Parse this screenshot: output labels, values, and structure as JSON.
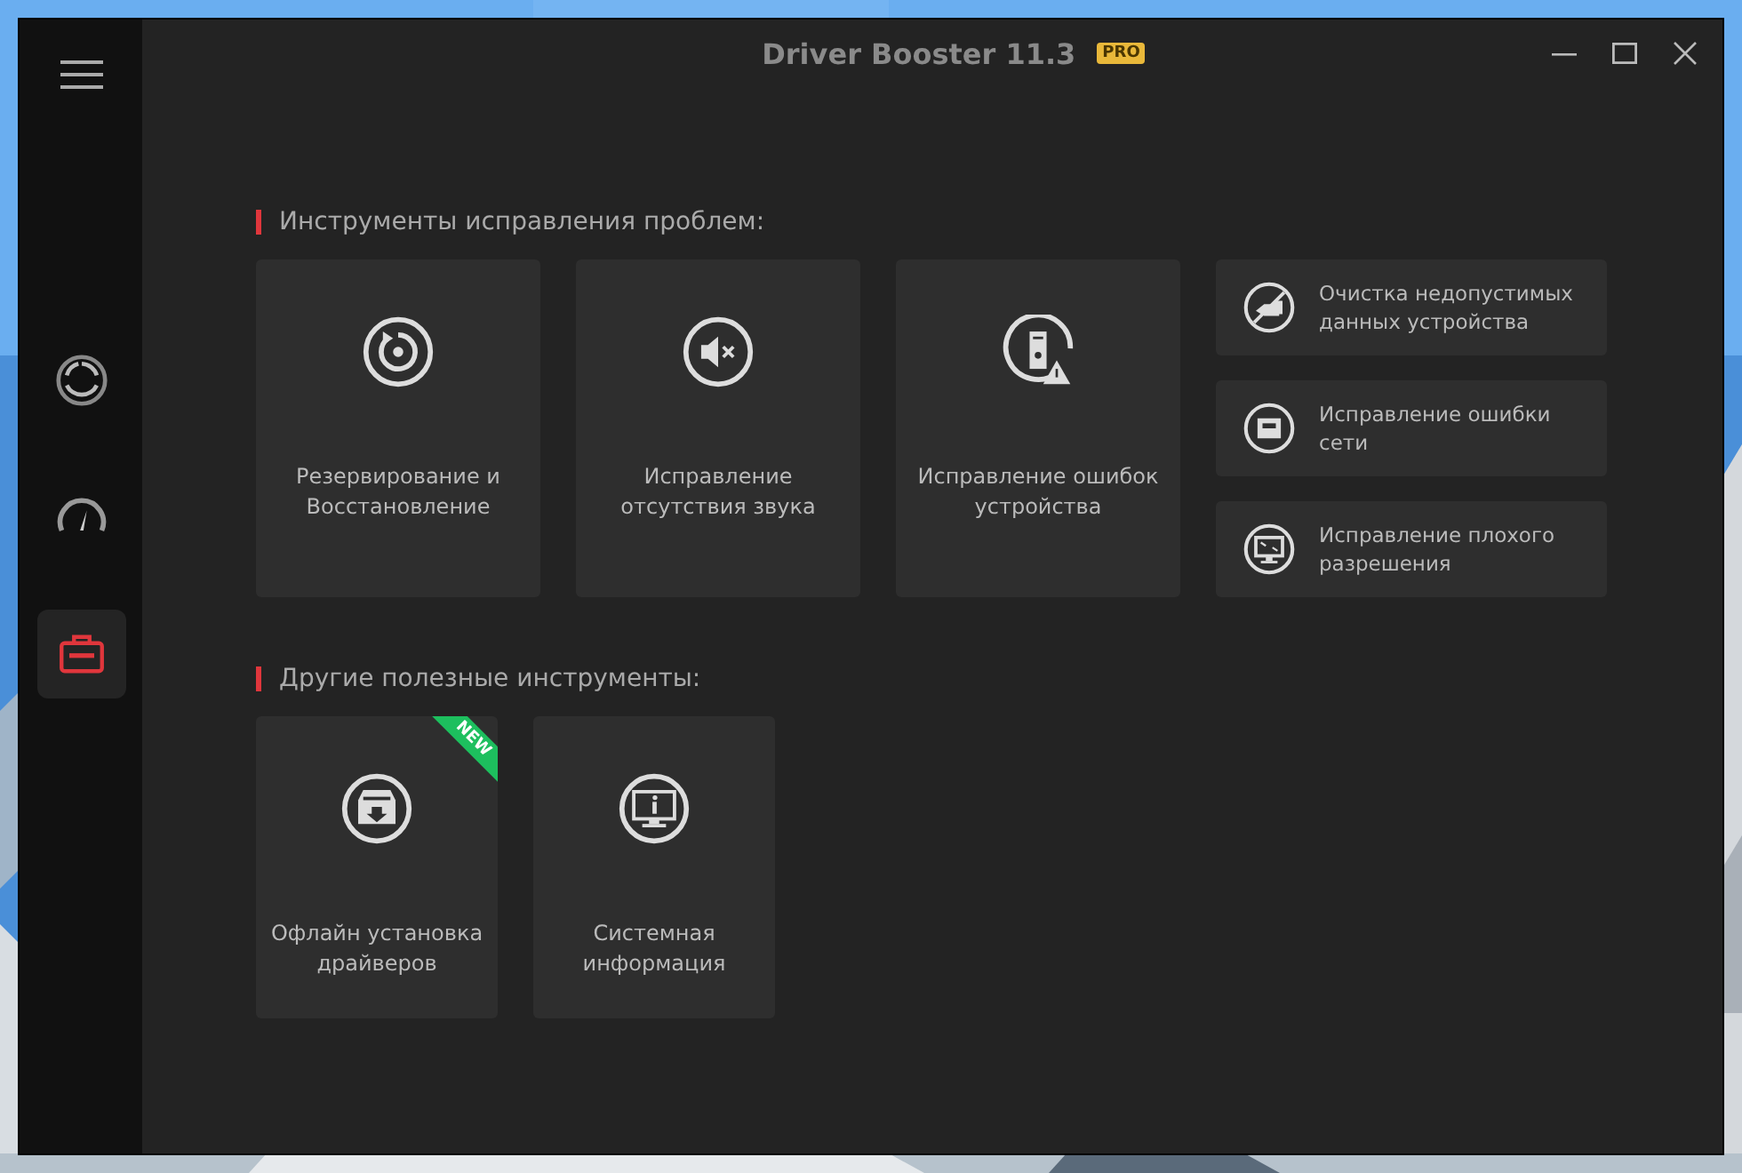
{
  "window": {
    "title": "Driver Booster 11.3",
    "badge": "PRO"
  },
  "sidebar": {
    "items": [
      {
        "kind": "scan",
        "selected": false
      },
      {
        "kind": "boost",
        "selected": false
      },
      {
        "kind": "toolbox",
        "selected": true
      }
    ]
  },
  "sections": [
    {
      "heading": "Инструменты исправления проблем:",
      "tools": [
        {
          "kind": "large",
          "label": "Резервирование и Восстановление"
        },
        {
          "kind": "large",
          "label": "Исправление отсутствия звука"
        },
        {
          "kind": "large",
          "label": "Исправление ошибок устройства"
        },
        {
          "kind": "small",
          "label": "Очистка недопустимых данных устройства"
        },
        {
          "kind": "small",
          "label": "Исправление ошибки сети"
        },
        {
          "kind": "small",
          "label": "Исправление плохого разрешения"
        }
      ]
    },
    {
      "heading": "Другие полезные инструменты:",
      "tools": [
        {
          "kind": "medium",
          "label": "Офлайн установка драйверов",
          "badge": "NEW"
        },
        {
          "kind": "medium",
          "label": "Системная информация"
        }
      ]
    }
  ]
}
